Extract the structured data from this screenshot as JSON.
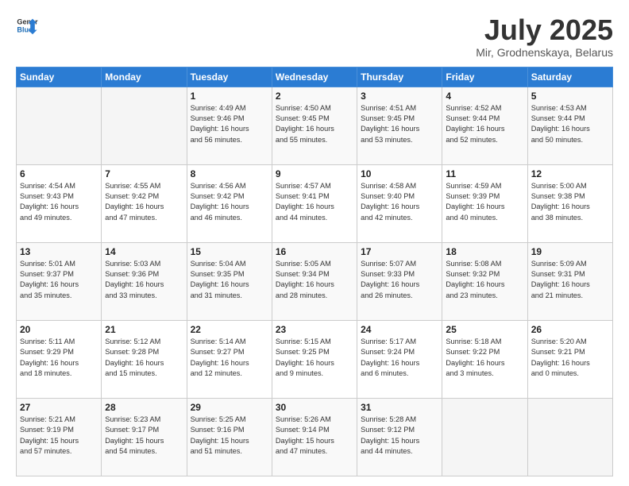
{
  "logo": {
    "line1": "General",
    "line2": "Blue"
  },
  "header": {
    "month": "July 2025",
    "location": "Mir, Grodnenskaya, Belarus"
  },
  "weekdays": [
    "Sunday",
    "Monday",
    "Tuesday",
    "Wednesday",
    "Thursday",
    "Friday",
    "Saturday"
  ],
  "weeks": [
    [
      {
        "day": "",
        "info": ""
      },
      {
        "day": "",
        "info": ""
      },
      {
        "day": "1",
        "info": "Sunrise: 4:49 AM\nSunset: 9:46 PM\nDaylight: 16 hours\nand 56 minutes."
      },
      {
        "day": "2",
        "info": "Sunrise: 4:50 AM\nSunset: 9:45 PM\nDaylight: 16 hours\nand 55 minutes."
      },
      {
        "day": "3",
        "info": "Sunrise: 4:51 AM\nSunset: 9:45 PM\nDaylight: 16 hours\nand 53 minutes."
      },
      {
        "day": "4",
        "info": "Sunrise: 4:52 AM\nSunset: 9:44 PM\nDaylight: 16 hours\nand 52 minutes."
      },
      {
        "day": "5",
        "info": "Sunrise: 4:53 AM\nSunset: 9:44 PM\nDaylight: 16 hours\nand 50 minutes."
      }
    ],
    [
      {
        "day": "6",
        "info": "Sunrise: 4:54 AM\nSunset: 9:43 PM\nDaylight: 16 hours\nand 49 minutes."
      },
      {
        "day": "7",
        "info": "Sunrise: 4:55 AM\nSunset: 9:42 PM\nDaylight: 16 hours\nand 47 minutes."
      },
      {
        "day": "8",
        "info": "Sunrise: 4:56 AM\nSunset: 9:42 PM\nDaylight: 16 hours\nand 46 minutes."
      },
      {
        "day": "9",
        "info": "Sunrise: 4:57 AM\nSunset: 9:41 PM\nDaylight: 16 hours\nand 44 minutes."
      },
      {
        "day": "10",
        "info": "Sunrise: 4:58 AM\nSunset: 9:40 PM\nDaylight: 16 hours\nand 42 minutes."
      },
      {
        "day": "11",
        "info": "Sunrise: 4:59 AM\nSunset: 9:39 PM\nDaylight: 16 hours\nand 40 minutes."
      },
      {
        "day": "12",
        "info": "Sunrise: 5:00 AM\nSunset: 9:38 PM\nDaylight: 16 hours\nand 38 minutes."
      }
    ],
    [
      {
        "day": "13",
        "info": "Sunrise: 5:01 AM\nSunset: 9:37 PM\nDaylight: 16 hours\nand 35 minutes."
      },
      {
        "day": "14",
        "info": "Sunrise: 5:03 AM\nSunset: 9:36 PM\nDaylight: 16 hours\nand 33 minutes."
      },
      {
        "day": "15",
        "info": "Sunrise: 5:04 AM\nSunset: 9:35 PM\nDaylight: 16 hours\nand 31 minutes."
      },
      {
        "day": "16",
        "info": "Sunrise: 5:05 AM\nSunset: 9:34 PM\nDaylight: 16 hours\nand 28 minutes."
      },
      {
        "day": "17",
        "info": "Sunrise: 5:07 AM\nSunset: 9:33 PM\nDaylight: 16 hours\nand 26 minutes."
      },
      {
        "day": "18",
        "info": "Sunrise: 5:08 AM\nSunset: 9:32 PM\nDaylight: 16 hours\nand 23 minutes."
      },
      {
        "day": "19",
        "info": "Sunrise: 5:09 AM\nSunset: 9:31 PM\nDaylight: 16 hours\nand 21 minutes."
      }
    ],
    [
      {
        "day": "20",
        "info": "Sunrise: 5:11 AM\nSunset: 9:29 PM\nDaylight: 16 hours\nand 18 minutes."
      },
      {
        "day": "21",
        "info": "Sunrise: 5:12 AM\nSunset: 9:28 PM\nDaylight: 16 hours\nand 15 minutes."
      },
      {
        "day": "22",
        "info": "Sunrise: 5:14 AM\nSunset: 9:27 PM\nDaylight: 16 hours\nand 12 minutes."
      },
      {
        "day": "23",
        "info": "Sunrise: 5:15 AM\nSunset: 9:25 PM\nDaylight: 16 hours\nand 9 minutes."
      },
      {
        "day": "24",
        "info": "Sunrise: 5:17 AM\nSunset: 9:24 PM\nDaylight: 16 hours\nand 6 minutes."
      },
      {
        "day": "25",
        "info": "Sunrise: 5:18 AM\nSunset: 9:22 PM\nDaylight: 16 hours\nand 3 minutes."
      },
      {
        "day": "26",
        "info": "Sunrise: 5:20 AM\nSunset: 9:21 PM\nDaylight: 16 hours\nand 0 minutes."
      }
    ],
    [
      {
        "day": "27",
        "info": "Sunrise: 5:21 AM\nSunset: 9:19 PM\nDaylight: 15 hours\nand 57 minutes."
      },
      {
        "day": "28",
        "info": "Sunrise: 5:23 AM\nSunset: 9:17 PM\nDaylight: 15 hours\nand 54 minutes."
      },
      {
        "day": "29",
        "info": "Sunrise: 5:25 AM\nSunset: 9:16 PM\nDaylight: 15 hours\nand 51 minutes."
      },
      {
        "day": "30",
        "info": "Sunrise: 5:26 AM\nSunset: 9:14 PM\nDaylight: 15 hours\nand 47 minutes."
      },
      {
        "day": "31",
        "info": "Sunrise: 5:28 AM\nSunset: 9:12 PM\nDaylight: 15 hours\nand 44 minutes."
      },
      {
        "day": "",
        "info": ""
      },
      {
        "day": "",
        "info": ""
      }
    ]
  ]
}
